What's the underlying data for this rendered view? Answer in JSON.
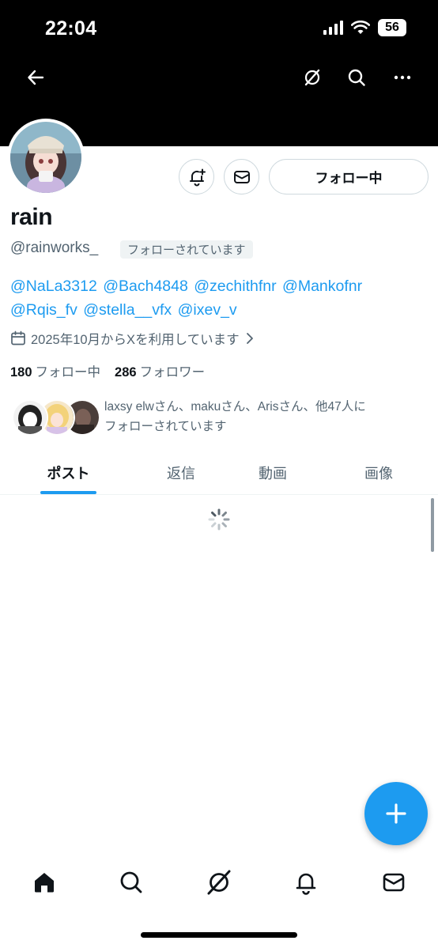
{
  "status_bar": {
    "time": "22:04",
    "battery": "56"
  },
  "header": {
    "icons": [
      "back-arrow-icon",
      "grok-icon",
      "search-icon",
      "more-icon"
    ]
  },
  "profile": {
    "name": "rain",
    "handle": "@rainworks_",
    "follows_you_label": "フォローされています",
    "follow_button_label": "フォロー中",
    "bio_mentions": [
      "@NaLa3312",
      "@Bach4848",
      "@zechithfnr",
      "@Mankofnr",
      "@Rqis_fv",
      "@stella__vfx",
      "@ixev_v"
    ],
    "joined": "2025年10月からXを利用しています",
    "following_count": "180",
    "following_label": "フォロー中",
    "followers_count": "286",
    "followers_label": "フォロワー",
    "known_followers_line1": "laxsy elwさん、makuさん、Arisさん、他47人に",
    "known_followers_line2": "フォローされています"
  },
  "tabs": [
    {
      "label": "ポスト",
      "active": true
    },
    {
      "label": "返信",
      "active": false
    },
    {
      "label": "動画",
      "active": false
    },
    {
      "label": "画像",
      "active": false
    }
  ],
  "bottom_nav": [
    "home-icon",
    "search-icon",
    "grok-icon",
    "notifications-icon",
    "messages-icon"
  ],
  "colors": {
    "accent": "#1d9bf0",
    "text_primary": "#0f1419",
    "text_secondary": "#536471",
    "border": "#cfd9de",
    "header_bg": "#000000"
  }
}
